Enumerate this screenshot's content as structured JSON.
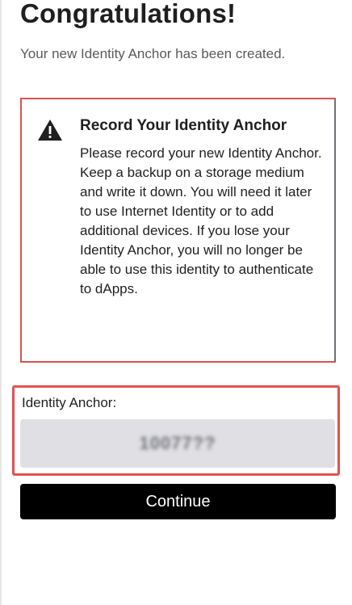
{
  "header": {
    "title": "Congratulations!",
    "subtitle": "Your new Identity Anchor has been created."
  },
  "warning": {
    "icon": "warning-triangle-icon",
    "title": "Record Your Identity Anchor",
    "body": "Please record your new Identity Anchor. Keep a backup on a storage medium and write it down. You will need it later to use Internet Identity or to add additional devices. If you lose your Identity Anchor, you will no longer be able to use this identity to authenticate to dApps."
  },
  "anchor": {
    "label": "Identity Anchor:",
    "value": "10077??"
  },
  "actions": {
    "continue_label": "Continue"
  },
  "colors": {
    "warning_border": "#d9534f",
    "highlight_frame": "#e05252",
    "field_background": "#e0dfe3",
    "button_background": "#000000",
    "button_text": "#ffffff"
  }
}
